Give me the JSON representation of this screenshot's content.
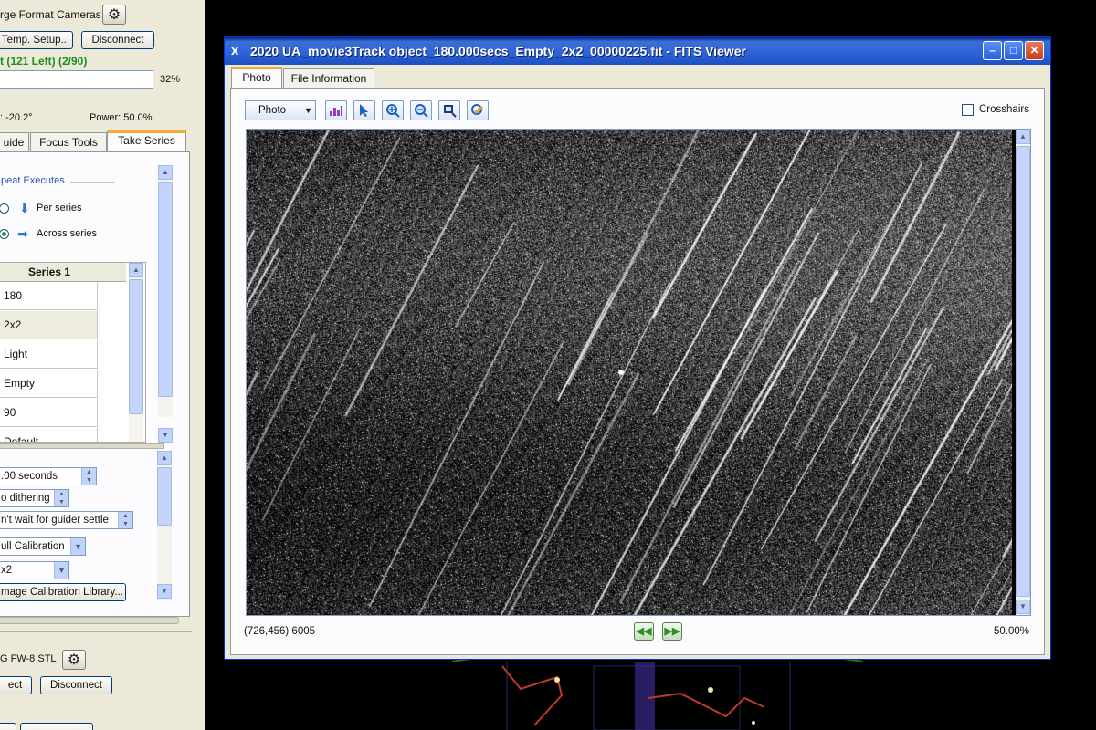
{
  "left_panel": {
    "camera_header": "rge Format Cameras",
    "temp_setup_button": "Temp. Setup...",
    "disconnect_button": "Disconnect",
    "status_line": "t (121 Left) (2/90)",
    "progress_percent": 32,
    "progress_label": "32%",
    "temperature": ": -20.2°",
    "power": "Power: 50.0%",
    "tabs": [
      "uide",
      "Focus Tools",
      "Take Series"
    ],
    "repeat_header": "peat Executes",
    "radio_per_series": "Per series",
    "radio_across_series": "Across series",
    "series_header": "Series 1",
    "series_cells": [
      "180",
      "2x2",
      "Light",
      "Empty",
      "90",
      "Default"
    ],
    "exposure": ".00 seconds",
    "dithering": "o dithering",
    "guider_settle": "n't wait for guider settle",
    "calibration": "ull Calibration",
    "binning": "x2",
    "calibration_library_button": "mage Calibration Library...",
    "filter_wheel": "G FW-8 STL",
    "connect_button": "ect",
    "disconnect2_button": "Disconnect"
  },
  "fits_viewer": {
    "title": "2020 UA_movie3Track object_180.000secs_Empty_2x2_00000225.fit - FITS Viewer",
    "tabs": [
      "Photo",
      "File Information"
    ],
    "view_select": "Photo",
    "crosshairs_label": "Crosshairs",
    "crosshairs_checked": false,
    "pixel_readout": "(726,456) 6005",
    "zoom": "50.00%"
  },
  "icons": {
    "title_icon": "x",
    "toolbar": [
      "histogram-icon",
      "pointer-icon",
      "zoom-in-icon",
      "zoom-out-icon",
      "zoom-fit-icon",
      "annotate-icon"
    ]
  },
  "colors": {
    "accent_status": "#1d8f1d",
    "titlebar": "#2d63d6",
    "tab_highlight": "#f7a932"
  }
}
